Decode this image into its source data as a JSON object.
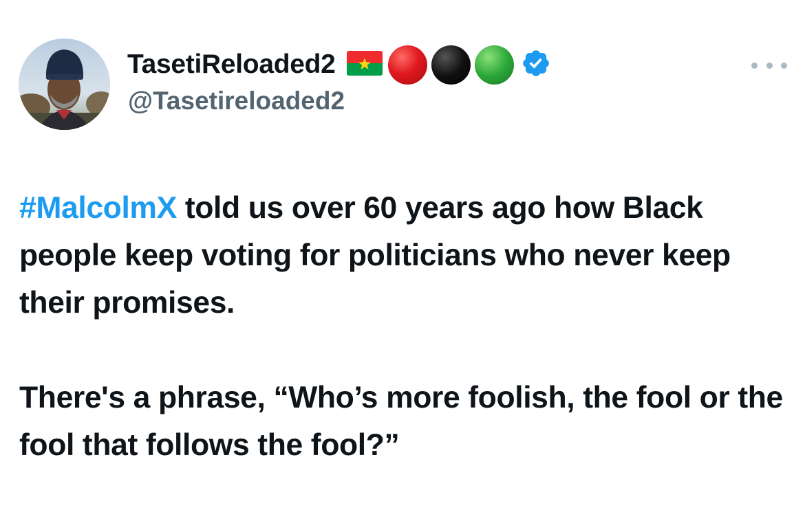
{
  "tweet": {
    "author": {
      "display_name": "TasetiReloaded2",
      "handle": "@Tasetireloaded2",
      "avatar": "avatar-photo",
      "name_badges": [
        "flag-burkina-faso-icon",
        "red-circle-icon",
        "black-circle-icon",
        "green-circle-icon"
      ],
      "verified": true
    },
    "more_icon": "more-horizontal-icon",
    "hashtag": "#MalcolmX",
    "text_line1_rest": " told us over 60 years ago how Black people keep voting for politicians who never keep their promises.",
    "text_para2": "There's a phrase, “Who’s more foolish, the fool or the fool that follows the fool?”"
  },
  "colors": {
    "link": "#1d9bf0",
    "secondary_text": "#536471",
    "verified": "#1d9bf0",
    "red_circle": "#e0191f",
    "black_circle": "#111111",
    "green_circle": "#2ea83a",
    "more_dots": "#aab8c2"
  }
}
